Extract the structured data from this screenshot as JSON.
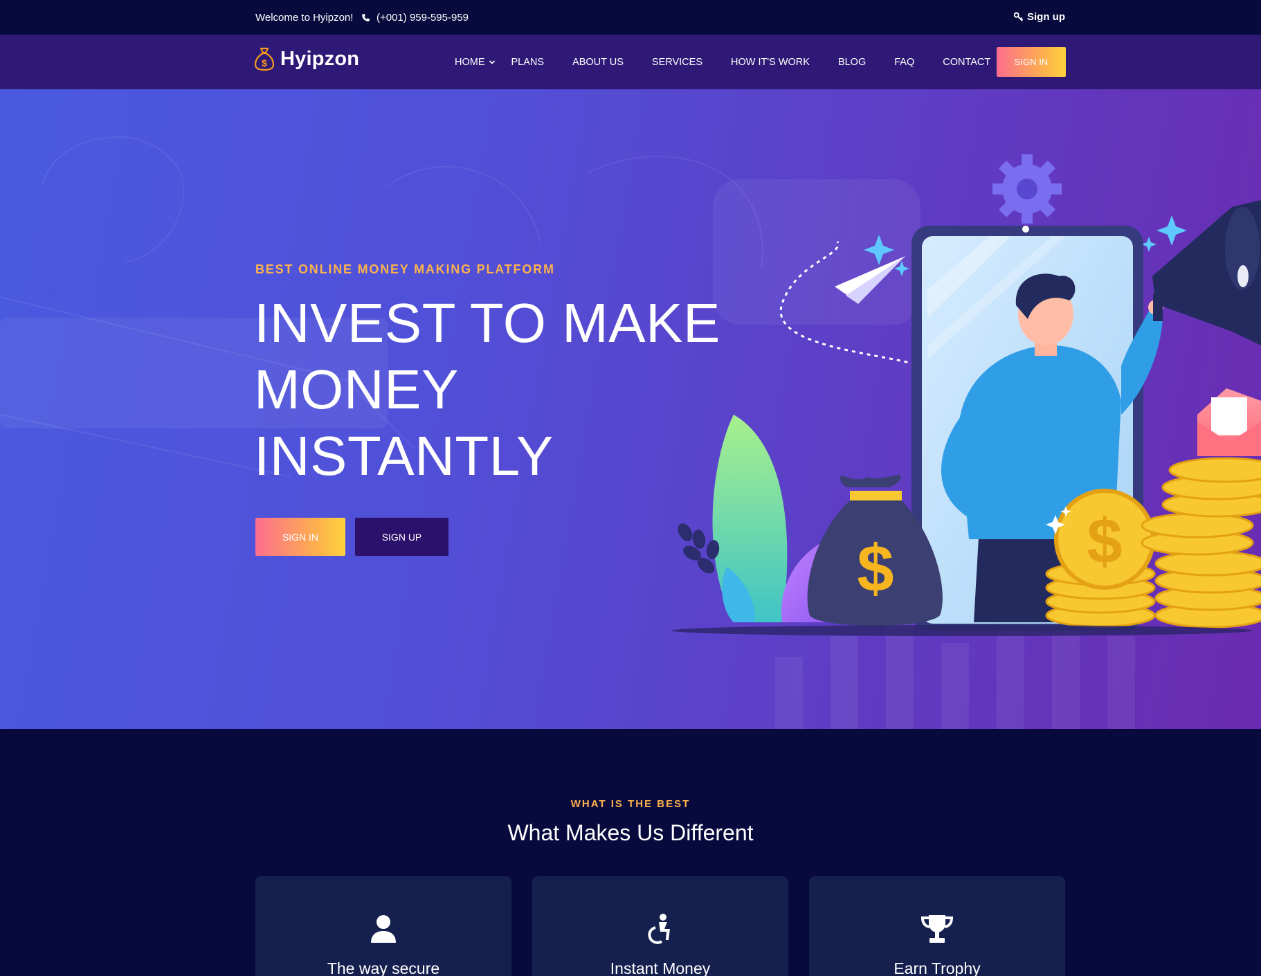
{
  "topbar": {
    "welcome": "Welcome to Hyipzon!",
    "phone": "(+001) 959-595-959",
    "signup_label": "Sign up"
  },
  "nav": {
    "logo_text": "Hyipzon",
    "items": [
      {
        "label": "HOME",
        "has_dropdown": true
      },
      {
        "label": "PLANS"
      },
      {
        "label": "ABOUT US"
      },
      {
        "label": "SERVICES"
      },
      {
        "label": "HOW IT'S WORK"
      },
      {
        "label": "BLOG"
      },
      {
        "label": "FAQ"
      },
      {
        "label": "CONTACT"
      }
    ],
    "signin_label": "SIGN IN"
  },
  "hero": {
    "kicker": "BEST ONLINE MONEY MAKING PLATFORM",
    "title_line1": "INVEST TO MAKE",
    "title_line2": "MONEY",
    "title_line3": "INSTANTLY",
    "signin_label": "SIGN IN",
    "signup_label": "SIGN UP"
  },
  "features": {
    "kicker": "WHAT IS THE BEST",
    "heading": "What Makes Us Different",
    "cards": [
      {
        "title": "The way secure",
        "icon": "user-icon"
      },
      {
        "title": "Instant Money",
        "icon": "accessibility-icon"
      },
      {
        "title": "Earn Trophy",
        "icon": "trophy-icon"
      }
    ]
  },
  "colors": {
    "accent_orange": "#fdb24c",
    "accent_pink": "#fc6e8e",
    "nav_bg": "#2e1977",
    "topbar_bg": "#080a3d",
    "dark_button": "#2b116b",
    "card_bg": "#15204f"
  }
}
